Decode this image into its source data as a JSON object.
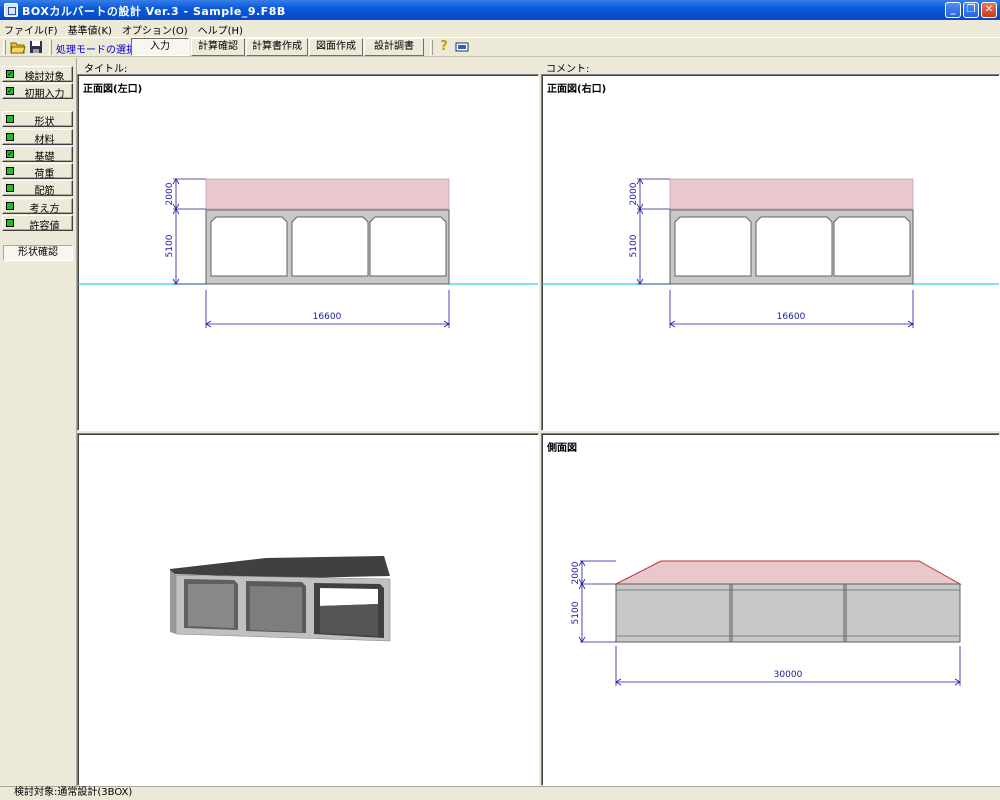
{
  "window": {
    "title": "BOXカルバートの設計 Ver.3 - Sample_9.F8B",
    "controls": {
      "minimize": "_",
      "restore": "❐",
      "close": "✕"
    }
  },
  "menu": [
    "ファイル(F)",
    "基準値(K)",
    "オプション(O)",
    "ヘルプ(H)"
  ],
  "toolbar": {
    "open_icon": "folder-open-icon",
    "save_icon": "save-icon",
    "mode_label": "処理モードの選択",
    "modes": [
      "入力",
      "計算確認",
      "計算書作成",
      "図面作成",
      "設計調書"
    ],
    "active_mode": "入力",
    "help_icon": "help-icon",
    "monitor_icon": "monitor-icon"
  },
  "sidebar": {
    "group1": [
      {
        "label": "検討対象",
        "checked": true
      },
      {
        "label": "初期入力",
        "checked": true
      }
    ],
    "group2": [
      {
        "label": "形状",
        "checked": false
      },
      {
        "label": "材料",
        "checked": false
      },
      {
        "label": "基礎",
        "checked": true
      },
      {
        "label": "荷重",
        "checked": false
      },
      {
        "label": "配筋",
        "checked": false
      },
      {
        "label": "考え方",
        "checked": false
      },
      {
        "label": "許容値",
        "checked": false
      }
    ],
    "shape_check": "形状確認"
  },
  "headers": {
    "title_label": "タイトル:",
    "comment_label": "コメント:"
  },
  "views": {
    "front_left": {
      "title": "正面図(左口)",
      "dim_top": "2000",
      "dim_height": "5100",
      "dim_width": "16600"
    },
    "front_right": {
      "title": "正面図(右口)",
      "dim_top": "2000",
      "dim_height": "5100",
      "dim_width": "16600"
    },
    "perspective": {
      "title": ""
    },
    "side": {
      "title": "側面図",
      "dim_top": "2000",
      "dim_height": "5100",
      "dim_width": "30000"
    }
  },
  "colors": {
    "fill_soil": "#e8c8cc",
    "concrete": "#c8c8c8",
    "dim": "#1a1aa0",
    "ground": "#00c8e0",
    "side_top": "#c03030"
  },
  "status": "検討対象:通常設計(3BOX)"
}
